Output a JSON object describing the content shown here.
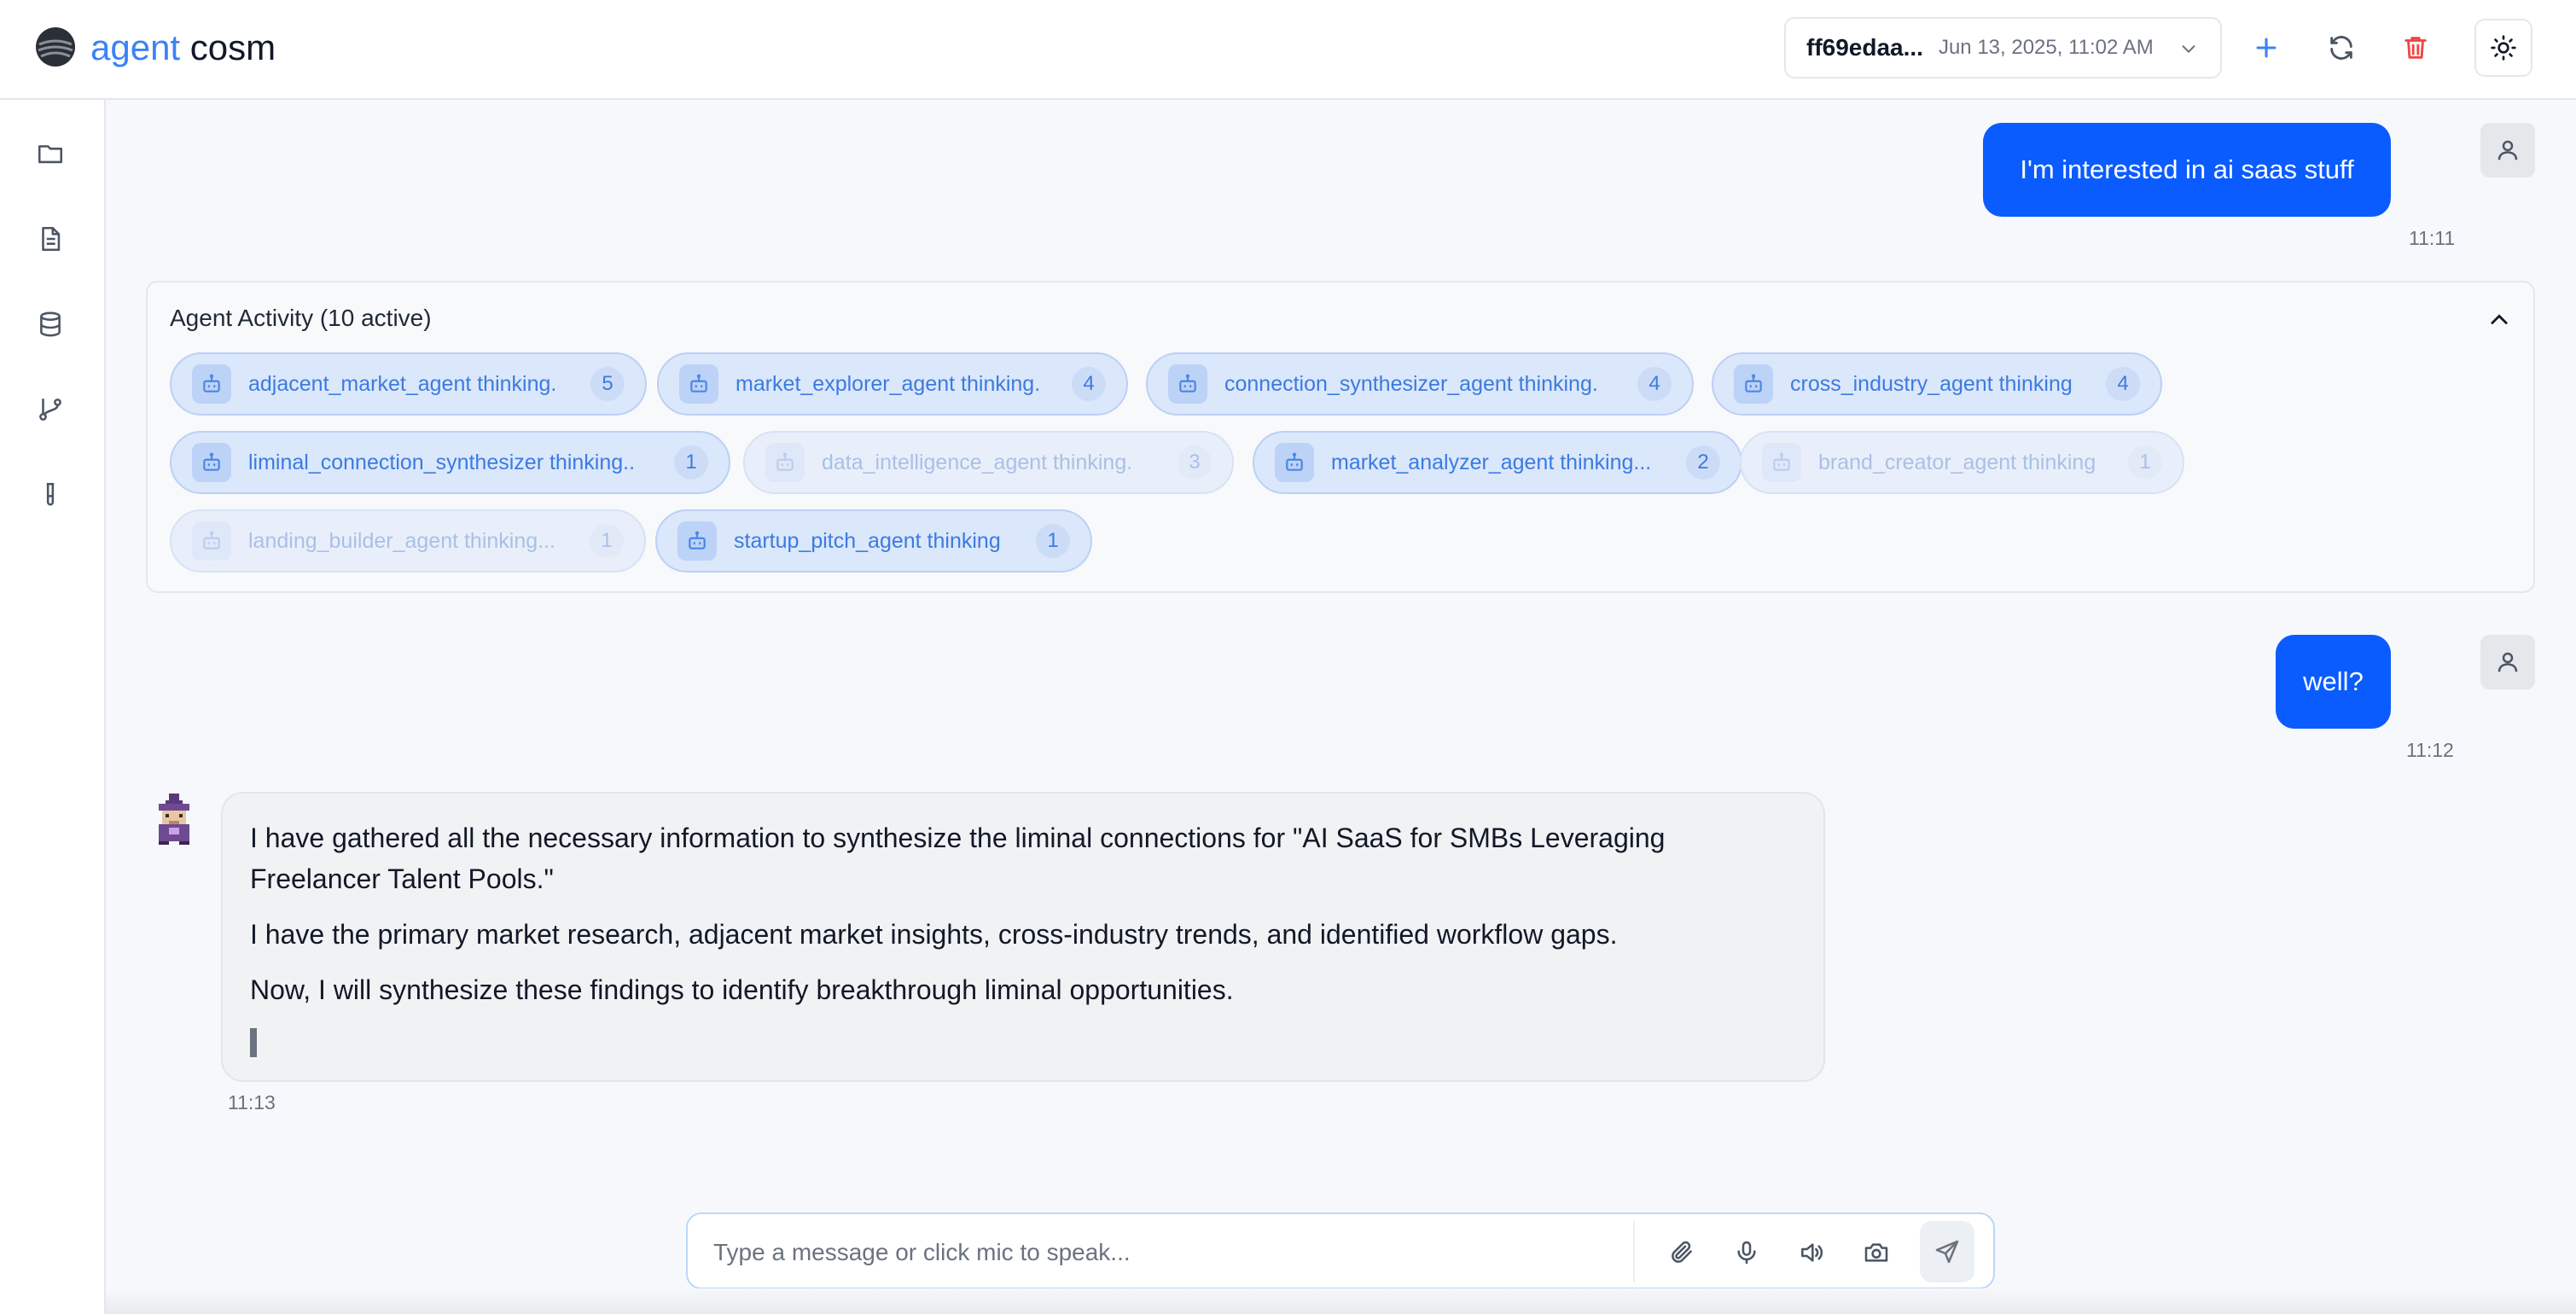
{
  "app": {
    "brand_part1": "agent",
    "brand_part2": "cosm"
  },
  "header": {
    "session_id": "ff69edaa...",
    "session_date": "Jun 13, 2025, 11:02 AM",
    "icons": [
      "plus-icon",
      "refresh-icon",
      "trash-icon",
      "sun-icon"
    ]
  },
  "sidebar": {
    "icons": [
      "folder-icon",
      "document-icon",
      "database-icon",
      "git-branch-icon",
      "test-tube-icon"
    ]
  },
  "messages": {
    "user1": {
      "text": "I'm interested in ai saas stuff",
      "time": "11:11"
    },
    "user2": {
      "text": "well?",
      "time": "11:12"
    },
    "assistant": {
      "paragraphs": [
        "I have gathered all the necessary information to synthesize the liminal connections for \"AI SaaS for SMBs Leveraging Freelancer Talent Pools.\"",
        "I have the primary market research, adjacent market insights, cross-industry trends, and identified workflow gaps.",
        "Now, I will synthesize these findings to identify breakthrough liminal opportunities."
      ],
      "time": "11:13"
    }
  },
  "activity": {
    "title": "Agent Activity (10 active)",
    "chips": [
      {
        "label": "adjacent_market_agent thinking.",
        "count": "5",
        "faded": false
      },
      {
        "label": "market_explorer_agent thinking.",
        "count": "4",
        "faded": false
      },
      {
        "label": "connection_synthesizer_agent thinking.",
        "count": "4",
        "faded": false
      },
      {
        "label": "cross_industry_agent thinking",
        "count": "4",
        "faded": false
      },
      {
        "label": "liminal_connection_synthesizer thinking..",
        "count": "1",
        "faded": false
      },
      {
        "label": "data_intelligence_agent thinking.",
        "count": "3",
        "faded": true
      },
      {
        "label": "market_analyzer_agent thinking...",
        "count": "2",
        "faded": false
      },
      {
        "label": "brand_creator_agent thinking",
        "count": "1",
        "faded": true
      },
      {
        "label": "landing_builder_agent thinking...",
        "count": "1",
        "faded": true
      },
      {
        "label": "startup_pitch_agent thinking",
        "count": "1",
        "faded": false
      }
    ]
  },
  "composer": {
    "placeholder": "Type a message or click mic to speak...",
    "icons": [
      "paperclip-icon",
      "microphone-icon",
      "speaker-icon",
      "camera-icon",
      "send-icon"
    ]
  }
}
